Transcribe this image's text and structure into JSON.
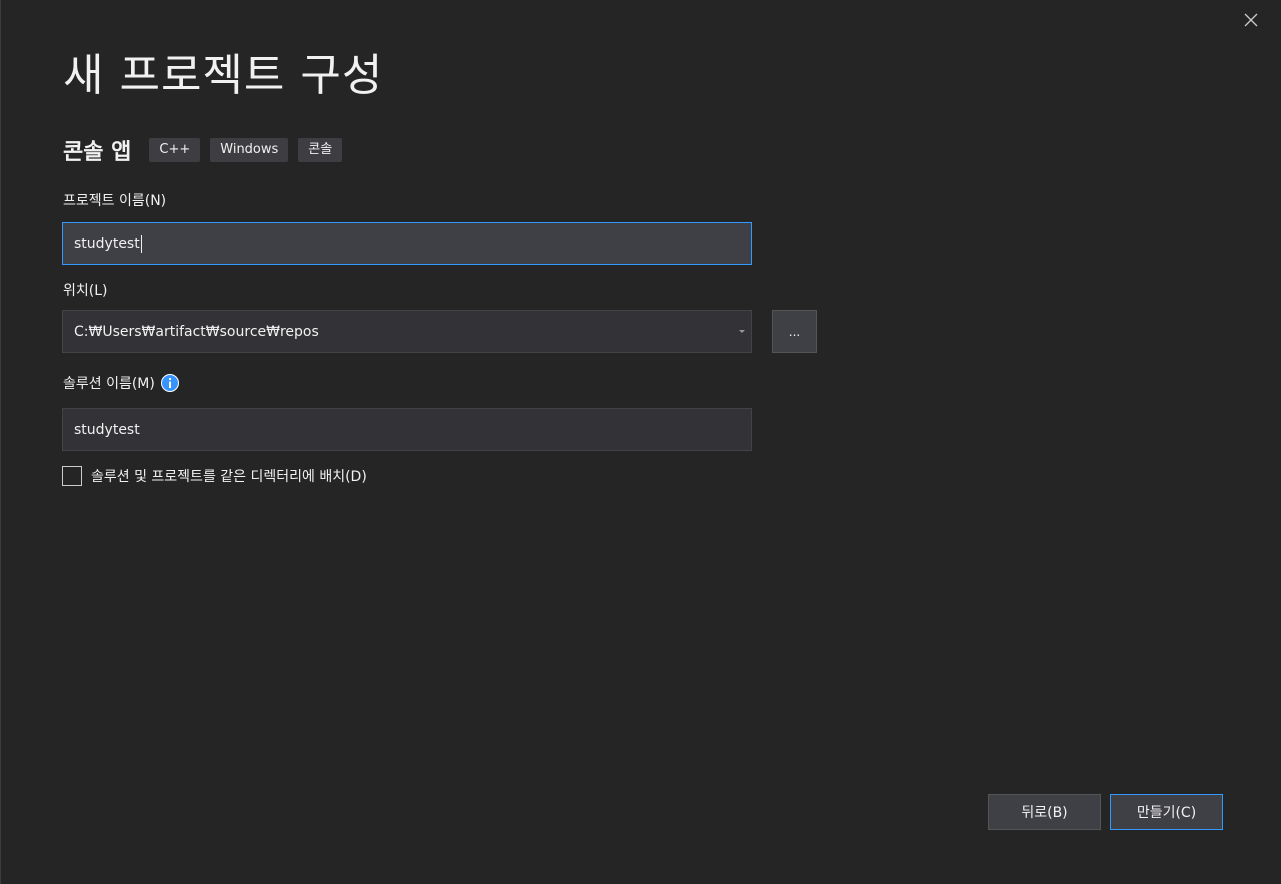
{
  "dialog": {
    "title": "새 프로젝트 구성",
    "template_name": "콘솔 앱",
    "tags": [
      "C++",
      "Windows",
      "콘솔"
    ]
  },
  "project_name": {
    "label": "프로젝트 이름(N)",
    "value": "studytest"
  },
  "location": {
    "label": "위치(L)",
    "value": "C:₩Users₩artifact₩source₩repos",
    "browse_label": "..."
  },
  "solution_name": {
    "label": "솔루션 이름(M)",
    "value": "studytest"
  },
  "same_directory": {
    "label": "솔루션 및 프로젝트를 같은 디렉터리에 배치(D)",
    "checked": false
  },
  "footer": {
    "back_label": "뒤로(B)",
    "create_label": "만들기(C)"
  },
  "colors": {
    "background": "#252526",
    "accent": "#3399ff",
    "info": "#3794ff"
  },
  "icons": {
    "close": "close-icon",
    "info": "info-icon",
    "dropdown": "chevron-down-icon"
  }
}
